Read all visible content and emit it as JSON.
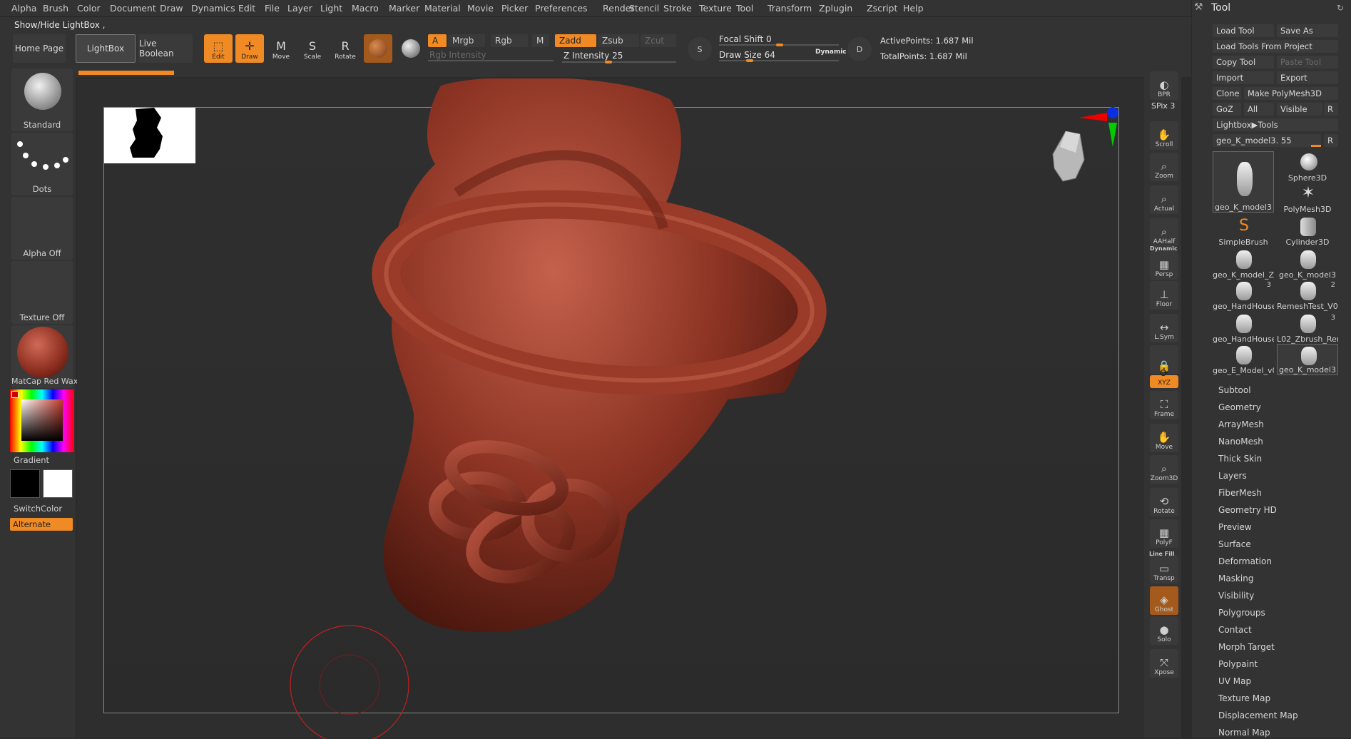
{
  "menu": [
    "Alpha",
    "Brush",
    "Color",
    "Document",
    "Draw",
    "Dynamics",
    "Edit",
    "File",
    "Layer",
    "Light",
    "Macro",
    "Marker",
    "Material",
    "Movie",
    "Picker",
    "Preferences",
    "Render",
    "Stencil",
    "Stroke",
    "Texture",
    "Tool",
    "Transform",
    "Zplugin",
    "Zscript",
    "Help"
  ],
  "status_text": "Show/Hide LightBox ,",
  "nav": {
    "home": "Home Page",
    "lightbox": "LightBox",
    "live_boolean": "Live Boolean"
  },
  "tools": {
    "edit": "Edit",
    "draw": "Draw",
    "move": "Move",
    "scale": "Scale",
    "rotate": "Rotate"
  },
  "color_modes": {
    "a": "A",
    "mrgb": "Mrgb",
    "rgb": "Rgb",
    "m": "M",
    "zadd": "Zadd",
    "zsub": "Zsub",
    "zcut": "Zcut"
  },
  "rgb_intensity": "Rgb Intensity",
  "z_intensity": {
    "label": "Z Intensity",
    "value": "25",
    "max": 100
  },
  "focal_shift": {
    "label": "Focal Shift",
    "value": "0"
  },
  "draw_size": {
    "label": "Draw Size",
    "value": "64",
    "dynamic": "Dynamic"
  },
  "points": {
    "active": "ActivePoints: 1.687 Mil",
    "total": "TotalPoints: 1.687 Mil"
  },
  "sym_labels": {
    "s": "S",
    "d": "D"
  },
  "left": {
    "brush": "Standard",
    "stroke": "Dots",
    "alpha": "Alpha Off",
    "texture": "Texture Off",
    "material": "MatCap Red Wax",
    "gradient": "Gradient",
    "switch_color": "SwitchColor",
    "alternate": "Alternate"
  },
  "right_strip": [
    {
      "label": "BPR",
      "icon": "bpr-icon"
    },
    {
      "label": "SPix 3",
      "icon": "spix-slider"
    },
    {
      "label": "Scroll",
      "icon": "scroll-icon"
    },
    {
      "label": "Zoom",
      "icon": "zoom-icon"
    },
    {
      "label": "Actual",
      "icon": "actual-icon"
    },
    {
      "label": "AAHalf",
      "icon": "aahalf-icon"
    },
    {
      "label": "Persp",
      "icon": "persp-icon"
    },
    {
      "label": "Floor",
      "icon": "floor-icon"
    },
    {
      "label": "L.Sym",
      "icon": "lsym-icon"
    },
    {
      "label": "",
      "icon": "lock-icon"
    },
    {
      "label": "XYZ",
      "icon": "xyz-icon"
    },
    {
      "label": "Frame",
      "icon": "frame-icon"
    },
    {
      "label": "Move",
      "icon": "move-icon"
    },
    {
      "label": "Zoom3D",
      "icon": "zoom3d-icon"
    },
    {
      "label": "Rotate",
      "icon": "rotate-icon"
    },
    {
      "label": "PolyF",
      "icon": "polyf-icon"
    },
    {
      "label": "Transp",
      "icon": "transp-icon"
    },
    {
      "label": "Ghost",
      "icon": "ghost-icon"
    },
    {
      "label": "Solo",
      "icon": "solo-icon"
    },
    {
      "label": "Xpose",
      "icon": "xpose-icon"
    }
  ],
  "right_strip_extra": {
    "dynamic": "Dynamic",
    "line_fill": "Line Fill"
  },
  "tool_panel": {
    "title": "Tool",
    "load_tool": "Load Tool",
    "save_as": "Save As",
    "load_from_project": "Load Tools From Project",
    "copy_tool": "Copy Tool",
    "paste_tool": "Paste Tool",
    "import": "Import",
    "export": "Export",
    "clone": "Clone",
    "make_polymesh": "Make PolyMesh3D",
    "goz": "GoZ",
    "all": "All",
    "visible": "Visible",
    "r": "R",
    "lightbox_tools": "Lightbox▶Tools",
    "current_tool": "geo_K_model3. 55",
    "tools": [
      {
        "name": "geo_K_model3",
        "count": ""
      },
      {
        "name": "Sphere3D",
        "count": ""
      },
      {
        "name": "PolyMesh3D",
        "count": ""
      },
      {
        "name": "SimpleBrush",
        "count": ""
      },
      {
        "name": "Cylinder3D",
        "count": ""
      },
      {
        "name": "geo_K_model_Zb",
        "count": ""
      },
      {
        "name": "geo_K_model3",
        "count": ""
      },
      {
        "name": "geo_HandHouse",
        "count": "3"
      },
      {
        "name": "RemeshTest_V02",
        "count": "2"
      },
      {
        "name": "geo_HandHouse",
        "count": ""
      },
      {
        "name": "L02_Zbrush_Rem",
        "count": "3"
      },
      {
        "name": "geo_E_Model_v0",
        "count": ""
      },
      {
        "name": "geo_K_model3",
        "count": ""
      }
    ],
    "subpalettes": [
      "Subtool",
      "Geometry",
      "ArrayMesh",
      "NanoMesh",
      "Thick Skin",
      "Layers",
      "FiberMesh",
      "Geometry HD",
      "Preview",
      "Surface",
      "Deformation",
      "Masking",
      "Visibility",
      "Polygroups",
      "Contact",
      "Morph Target",
      "Polypaint",
      "UV Map",
      "Texture Map",
      "Displacement Map",
      "Normal Map"
    ]
  },
  "colors": {
    "accent": "#f08a24",
    "background": "#2b2b2b",
    "panel": "#333333",
    "wax": "#9a3a2a"
  }
}
